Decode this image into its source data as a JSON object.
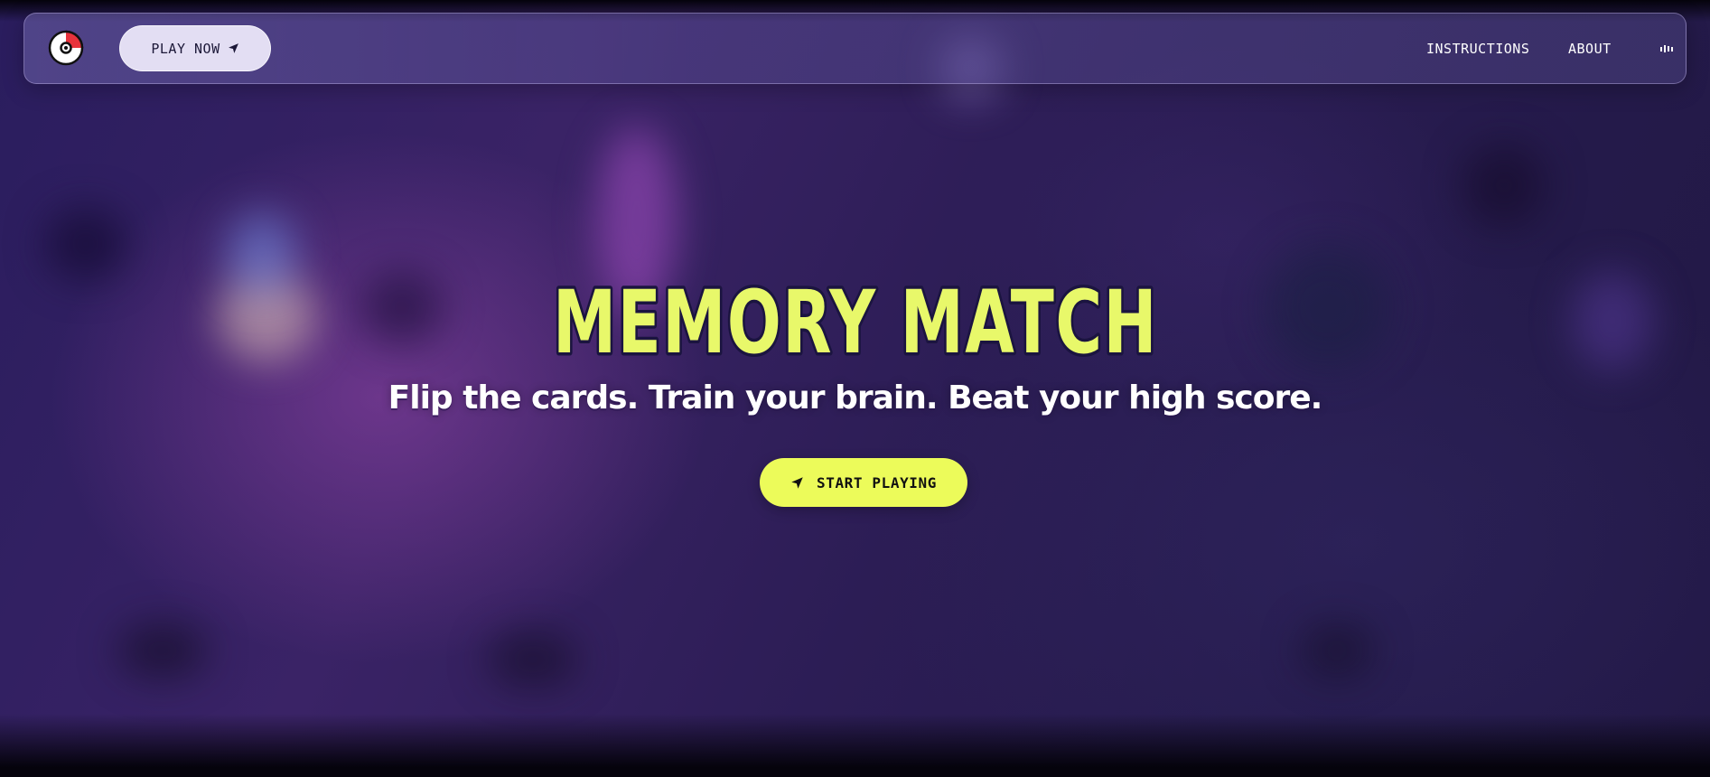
{
  "nav": {
    "play_now_label": "PLAY NOW",
    "links": [
      {
        "label": "INSTRUCTIONS"
      },
      {
        "label": "ABOUT"
      }
    ],
    "logo_icon": "pokeball-icon",
    "sound_icon": "sound-bars-icon"
  },
  "hero": {
    "title": "MEMORY MATCH",
    "subtitle": "Flip the cards. Train your brain. Beat your high score.",
    "cta_label": "START PLAYING",
    "cta_icon": "navigation-arrow-icon"
  },
  "colors": {
    "accent": "#ECFB5A",
    "title_fill": "#E8F86A",
    "title_outline": "#1B1440",
    "nav_button_bg": "#E3DEF3",
    "background": "#2C1D55"
  }
}
